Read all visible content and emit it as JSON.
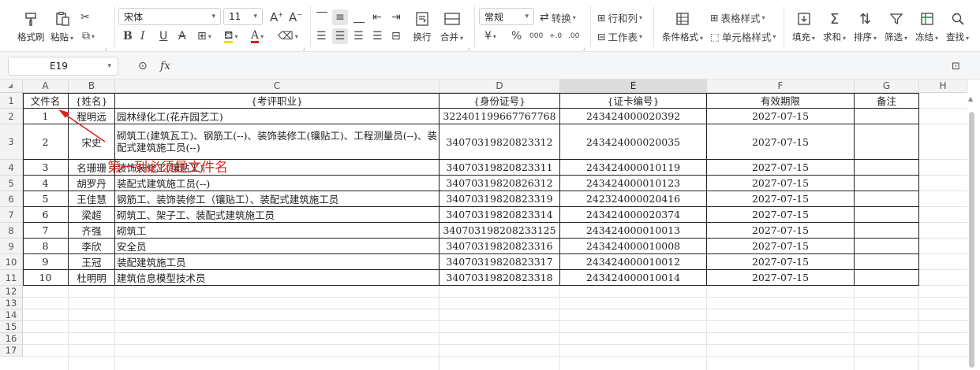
{
  "ribbon": {
    "format_painter": "格式刷",
    "paste": "粘贴",
    "font_name": "宋体",
    "font_size": "11",
    "wrap_text": "换行",
    "merge": "合并",
    "number_format": "常规",
    "convert": "转换",
    "rows_cols": "行和列",
    "worksheet": "工作表",
    "conditional_format": "条件格式",
    "table_style": "表格样式",
    "cell_style": "单元格样式",
    "fill": "填充",
    "sum": "求和",
    "sort": "排序",
    "filter": "筛选",
    "freeze": "冻结",
    "find": "查找",
    "currency_symbol": "¥",
    "percent_symbol": "%",
    "thousands_symbol": "000"
  },
  "formula_bar": {
    "cell_ref": "E19",
    "fx": "fx",
    "value": ""
  },
  "sheet": {
    "columns": [
      "A",
      "B",
      "C",
      "D",
      "E",
      "F",
      "G",
      "H"
    ],
    "selected_column": "E",
    "row_numbers": [
      "1",
      "2",
      "3",
      "4",
      "5",
      "6",
      "7",
      "8",
      "9",
      "10",
      "11",
      "12",
      "13",
      "14",
      "15",
      "16",
      "17"
    ],
    "headers": [
      "文件名",
      "{姓名}",
      "{考评职业}",
      "{身份证号}",
      "{证卡编号}",
      "有效期限",
      "备注"
    ],
    "rows": [
      {
        "no": "1",
        "name": "程明远",
        "job": "园林绿化工(花卉园艺工)",
        "id": "322401199667767768",
        "card": "243424000020392",
        "expiry": "2027-07-15",
        "note": ""
      },
      {
        "no": "2",
        "name": "宋史",
        "job": "砌筑工(建筑瓦工)、钢筋工(--)、装饰装修工(镶贴工)、工程测量员(--)、装配式建筑施工员(--)",
        "id": "34070319820823312",
        "card": "243424000020035",
        "expiry": "2027-07-15",
        "note": ""
      },
      {
        "no": "3",
        "name": "名珊珊",
        "job": "装饰装修工(镶贴工)",
        "id": "34070319820823311",
        "card": "243424000010119",
        "expiry": "2027-07-15",
        "note": ""
      },
      {
        "no": "4",
        "name": "胡罗丹",
        "job": "装配式建筑施工员(--)",
        "id": "34070319820826312",
        "card": "243424000010123",
        "expiry": "2027-07-15",
        "note": ""
      },
      {
        "no": "5",
        "name": "王佳慧",
        "job": "钢筋工、装饰装修工（镶贴工）、装配式建筑施工员",
        "id": "34070319820823319",
        "card": "242324000020416",
        "expiry": "2027-07-15",
        "note": ""
      },
      {
        "no": "6",
        "name": "梁超",
        "job": "砌筑工、架子工、装配式建筑施工员",
        "id": "34070319820823314",
        "card": "243424000020374",
        "expiry": "2027-07-15",
        "note": ""
      },
      {
        "no": "7",
        "name": "齐强",
        "job": "砌筑工",
        "id": "340703198208233125",
        "card": "243424000010013",
        "expiry": "2027-07-15",
        "note": ""
      },
      {
        "no": "8",
        "name": "李欣",
        "job": "安全员",
        "id": "34070319820823316",
        "card": "243424000010008",
        "expiry": "2027-07-15",
        "note": ""
      },
      {
        "no": "9",
        "name": "王冠",
        "job": "装配建筑施工员",
        "id": "34070319820823317",
        "card": "243424000010012",
        "expiry": "2027-07-15",
        "note": ""
      },
      {
        "no": "10",
        "name": "杜明明",
        "job": "建筑信息模型技术员",
        "id": "34070319820823318",
        "card": "243424000010014",
        "expiry": "2027-07-15",
        "note": ""
      }
    ]
  },
  "annotation": {
    "text": "第一列必须是文件名",
    "color": "#d9261c"
  },
  "colors": {
    "ribbon_bg": "#ffffff",
    "header_bg": "#f3f3f3",
    "selected_header_bg": "#dcdcdc",
    "font_color_red": "#e0201b",
    "highlight_yellow": "#f5e000"
  }
}
